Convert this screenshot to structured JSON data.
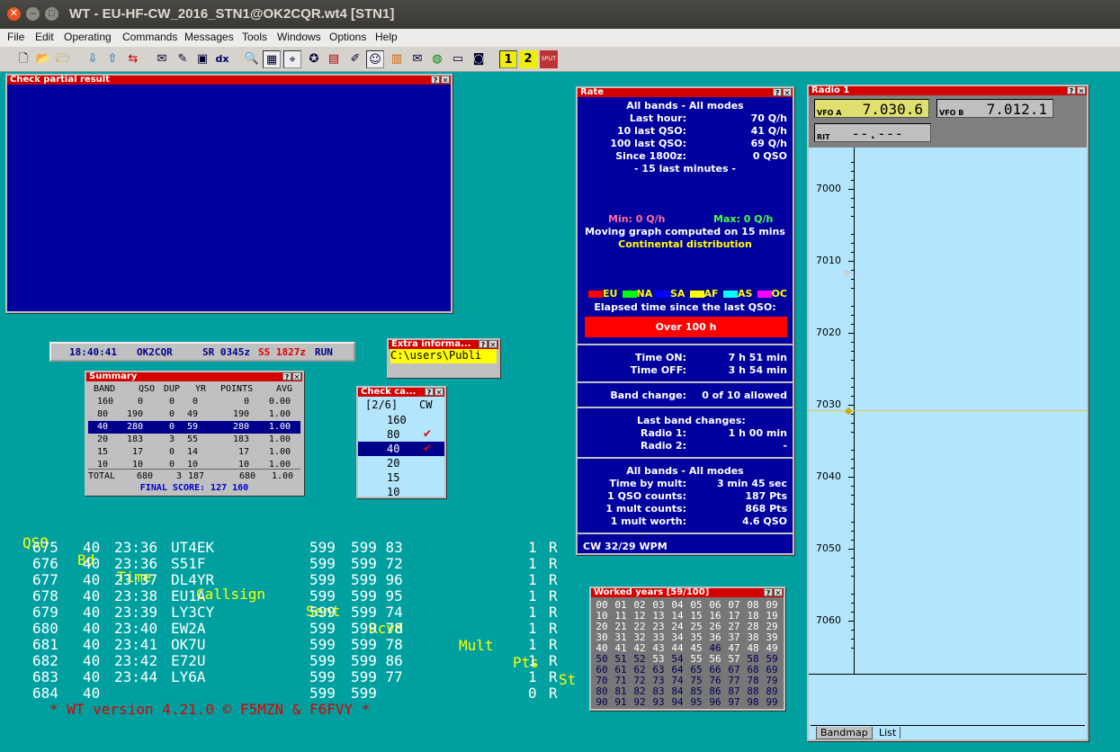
{
  "window": {
    "title": "WT - EU-HF-CW_2016_STN1@OK2CQR.wt4 [STN1]",
    "close": "✕",
    "min": "–",
    "max": "□"
  },
  "menu": [
    "File",
    "Edit",
    "Operating",
    "Commands",
    "Messages",
    "Tools",
    "Windows",
    "Options",
    "Help"
  ],
  "toolbar": {
    "dx": "dx",
    "split": "SPLIT",
    "one": "1",
    "two": "2"
  },
  "check_partial": {
    "title": "Check partial result"
  },
  "status": {
    "time": "18:40:41",
    "call": "OK2CQR",
    "sr": "SR 0345z",
    "ss": "SS 1827z",
    "run": "RUN"
  },
  "extra": {
    "title": "Extra informa...",
    "value": "C:\\users\\Publi"
  },
  "summary": {
    "title": "Summary",
    "headers": [
      "BAND",
      "QSO",
      "DUP",
      "YR",
      "POINTS",
      "AVG"
    ],
    "rows": [
      [
        "160",
        "0",
        "0",
        "0",
        "0",
        "0.00"
      ],
      [
        "80",
        "190",
        "0",
        "49",
        "190",
        "1.00"
      ],
      [
        "40",
        "280",
        "0",
        "59",
        "280",
        "1.00"
      ],
      [
        "20",
        "183",
        "3",
        "55",
        "183",
        "1.00"
      ],
      [
        "15",
        "17",
        "0",
        "14",
        "17",
        "1.00"
      ],
      [
        "10",
        "10",
        "0",
        "10",
        "10",
        "1.00"
      ]
    ],
    "total": [
      "TOTAL",
      "680",
      "3",
      "187",
      "680",
      "1.00"
    ],
    "final": "FINAL SCORE: 127 160"
  },
  "checkcall": {
    "title": "Check ca...",
    "header": "[2/6]",
    "mode": "CW",
    "bands": [
      "160",
      "80",
      "40",
      "20",
      "15",
      "10"
    ],
    "checked": [
      false,
      true,
      true,
      false,
      false,
      false
    ]
  },
  "log": {
    "headers": [
      "QSO",
      "Bd",
      "Time",
      "Callsign",
      "Sent",
      "Rcvd",
      "Mult",
      "Pts",
      "St"
    ],
    "rows": [
      [
        "675",
        "40",
        "23:36",
        "UT4EK",
        "599",
        "599 83",
        "",
        "1",
        "R"
      ],
      [
        "676",
        "40",
        "23:36",
        "S51F",
        "599",
        "599 72",
        "",
        "1",
        "R"
      ],
      [
        "677",
        "40",
        "23:37",
        "DL4YR",
        "599",
        "599 96",
        "",
        "1",
        "R"
      ],
      [
        "678",
        "40",
        "23:38",
        "EU1A",
        "599",
        "599 95",
        "",
        "1",
        "R"
      ],
      [
        "679",
        "40",
        "23:39",
        "LY3CY",
        "599",
        "599 74",
        "",
        "1",
        "R"
      ],
      [
        "680",
        "40",
        "23:40",
        "EW2A",
        "599",
        "599 78",
        "",
        "1",
        "R"
      ],
      [
        "681",
        "40",
        "23:41",
        "OK7U",
        "599",
        "599 78",
        "",
        "1",
        "R"
      ],
      [
        "682",
        "40",
        "23:42",
        "E72U",
        "599",
        "599 86",
        "",
        "1",
        "R"
      ],
      [
        "683",
        "40",
        "23:44",
        "LY6A",
        "599",
        "599 77",
        "",
        "1",
        "R"
      ],
      [
        "684",
        "40",
        "",
        "",
        "599",
        "599",
        "",
        "0",
        "R"
      ]
    ],
    "footer": "* WT version 4.21.0 © F5MZN & F6FVY *"
  },
  "rate": {
    "title": "Rate",
    "heading": "All bands - All modes",
    "stats": [
      [
        "Last hour:",
        "70 Q/h"
      ],
      [
        "10 last QSO:",
        "41 Q/h"
      ],
      [
        "100 last QSO:",
        "69 Q/h"
      ],
      [
        "Since 1800z:",
        "0 QSO"
      ]
    ],
    "window": "- 15 last minutes -",
    "min": "Min: 0 Q/h",
    "max": "Max: 0 Q/h",
    "moving": "Moving graph computed on 15 mins",
    "continental": "Continental distribution",
    "legend": [
      "EU",
      "NA",
      "SA",
      "AF",
      "AS",
      "OC"
    ],
    "legend_colors": [
      "#ff0000",
      "#00ff00",
      "#0000ff",
      "#ffff00",
      "#00ffff",
      "#ff00ff"
    ],
    "elapsed_label": "Elapsed time since the last QSO:",
    "elapsed": "Over 100 h",
    "time_on_label": "Time ON:",
    "time_on": "7 h 51 min",
    "time_off_label": "Time OFF:",
    "time_off": "3 h 54 min",
    "band_change_label": "Band change:",
    "band_change": "0 of 10 allowed",
    "last_band_changes": "Last band changes:",
    "radio1_label": "Radio 1:",
    "radio1": "1 h 00 min",
    "radio2_label": "Radio 2:",
    "radio2": "-",
    "heading2": "All bands - All modes",
    "mult": [
      [
        "Time by mult:",
        "3 min 45 sec"
      ],
      [
        "1 QSO counts:",
        "187 Pts"
      ],
      [
        "1 mult counts:",
        "868 Pts"
      ],
      [
        "1 mult worth:",
        "4.6 QSO"
      ]
    ],
    "cw": "CW  32/29 WPM"
  },
  "worked_years": {
    "title": "Worked years [59/100]",
    "bold": [
      0,
      1,
      2,
      3,
      4,
      5,
      6,
      7,
      8,
      9,
      10,
      11,
      12,
      13,
      14,
      15,
      16,
      17,
      18,
      19,
      20,
      21,
      22,
      23,
      24,
      25,
      26,
      27,
      28,
      29,
      30,
      31,
      32,
      33,
      34,
      35,
      36,
      37,
      38,
      39,
      40,
      41,
      42,
      43,
      44,
      45,
      47,
      48,
      49,
      53,
      55,
      56,
      57
    ]
  },
  "radio": {
    "title": "Radio 1",
    "vfoa_label": "VFO A",
    "vfoa": "7.030.6",
    "vfob_label": "VFO B",
    "vfob": "7.012.1",
    "rit_label": "RIT",
    "rit": "--.---",
    "scale": [
      "7000",
      "7010",
      "7020",
      "7030",
      "7040",
      "7050",
      "7060"
    ],
    "tabs": [
      "Bandmap",
      "List"
    ]
  }
}
